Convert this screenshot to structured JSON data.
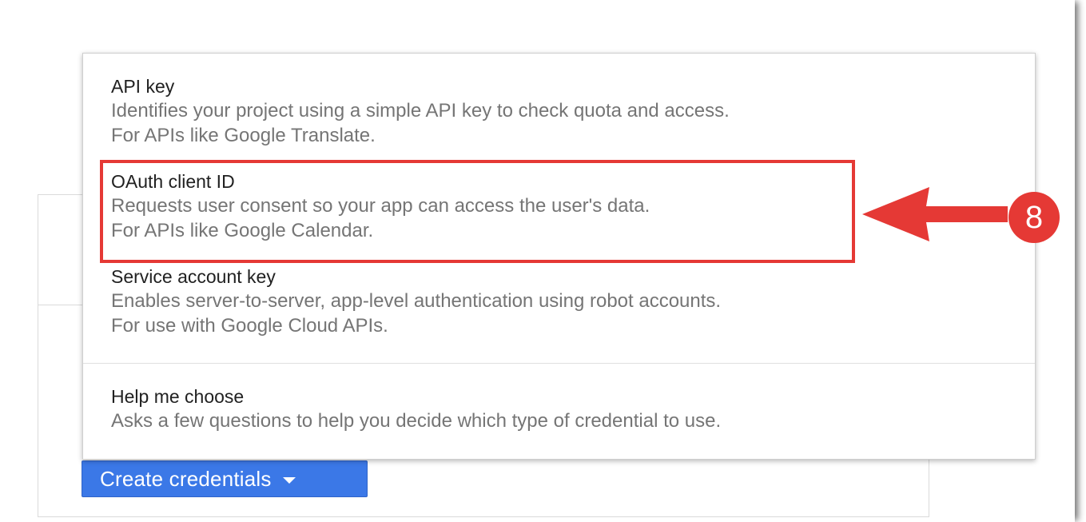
{
  "menu": {
    "items": [
      {
        "title": "API key",
        "desc_line1": "Identifies your project using a simple API key to check quota and access.",
        "desc_line2": "For APIs like Google Translate."
      },
      {
        "title": "OAuth client ID",
        "desc_line1": "Requests user consent so your app can access the user's data.",
        "desc_line2": "For APIs like Google Calendar."
      },
      {
        "title": "Service account key",
        "desc_line1": "Enables server-to-server, app-level authentication using robot accounts.",
        "desc_line2": "For use with Google Cloud APIs."
      },
      {
        "title": "Help me choose",
        "desc_line1": "Asks a few questions to help you decide which type of credential to use."
      }
    ]
  },
  "create_button": {
    "label": "Create credentials",
    "icon": "caret-down-icon",
    "color": "#3b78e7"
  },
  "annotation": {
    "step_number": "8",
    "color": "#e53935",
    "arrow_icon": "arrow-left-icon"
  }
}
